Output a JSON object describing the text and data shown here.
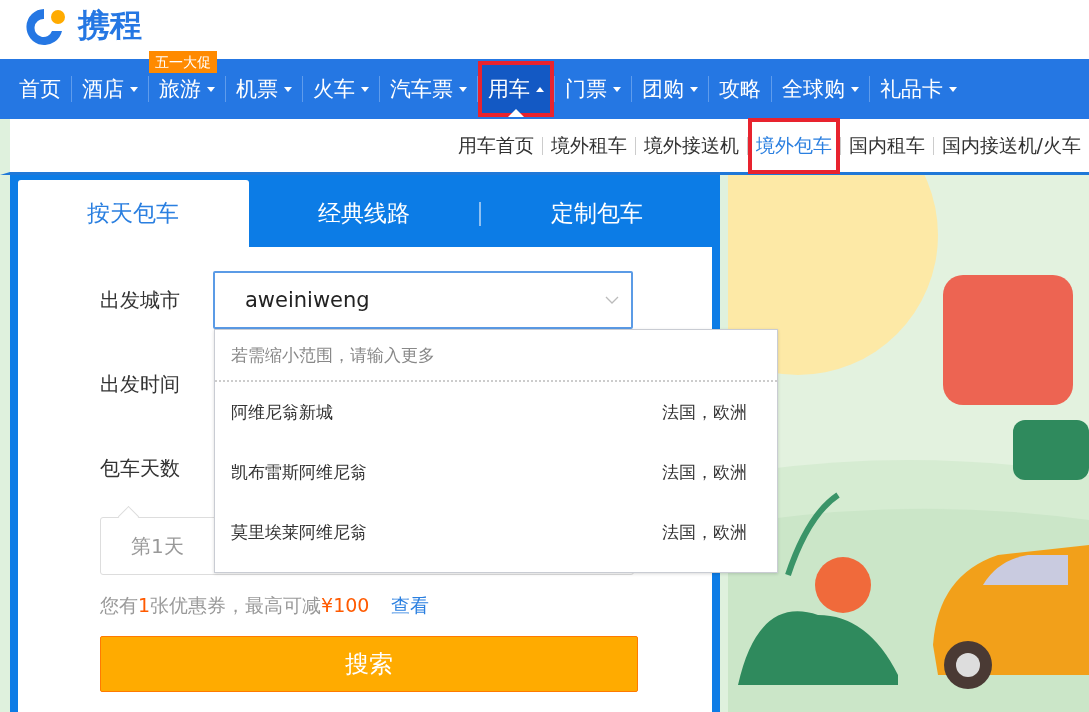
{
  "logo": {
    "text": "携程"
  },
  "nav": [
    {
      "label": "首页",
      "has_menu": false,
      "selected": false,
      "highlighted": false
    },
    {
      "label": "酒店",
      "has_menu": true,
      "selected": false,
      "highlighted": false
    },
    {
      "label": "旅游",
      "has_menu": true,
      "selected": false,
      "highlighted": false,
      "badge": "五一大促"
    },
    {
      "label": "机票",
      "has_menu": true,
      "selected": false,
      "highlighted": false
    },
    {
      "label": "火车",
      "has_menu": true,
      "selected": false,
      "highlighted": false
    },
    {
      "label": "汽车票",
      "has_menu": true,
      "selected": false,
      "highlighted": false
    },
    {
      "label": "用车",
      "has_menu": true,
      "selected": true,
      "highlighted": true
    },
    {
      "label": "门票",
      "has_menu": true,
      "selected": false,
      "highlighted": false
    },
    {
      "label": "团购",
      "has_menu": true,
      "selected": false,
      "highlighted": false
    },
    {
      "label": "攻略",
      "has_menu": false,
      "selected": false,
      "highlighted": false
    },
    {
      "label": "全球购",
      "has_menu": true,
      "selected": false,
      "highlighted": false
    },
    {
      "label": "礼品卡",
      "has_menu": true,
      "selected": false,
      "highlighted": false
    }
  ],
  "subnav": [
    {
      "label": "用车首页",
      "selected": false,
      "highlighted": false
    },
    {
      "label": "境外租车",
      "selected": false,
      "highlighted": false
    },
    {
      "label": "境外接送机",
      "selected": false,
      "highlighted": false
    },
    {
      "label": "境外包车",
      "selected": true,
      "highlighted": true
    },
    {
      "label": "国内租车",
      "selected": false,
      "highlighted": false
    },
    {
      "label": "国内接送机/火车",
      "selected": false,
      "highlighted": false
    }
  ],
  "tabs": [
    {
      "label": "按天包车",
      "selected": true
    },
    {
      "label": "经典线路",
      "selected": false
    },
    {
      "label": "定制包车",
      "selected": false
    }
  ],
  "form": {
    "city_label": "出发城市",
    "city_value": "aweiniweng",
    "time_label": "出发时间",
    "days_label": "包车天数",
    "day_chip": "第1天"
  },
  "suggestions": {
    "hint": "若需缩小范围，请输入更多",
    "items": [
      {
        "name": "阿维尼翁新城",
        "region": "法国，欧洲"
      },
      {
        "name": "凯布雷斯阿维尼翁",
        "region": "法国，欧洲"
      },
      {
        "name": "莫里埃莱阿维尼翁",
        "region": "法国，欧洲"
      }
    ]
  },
  "coupon": {
    "prefix": "您有",
    "count": "1",
    "middle": "张优惠券，最高可减",
    "amount": "¥100",
    "link": "查看"
  },
  "search_button": "搜索"
}
